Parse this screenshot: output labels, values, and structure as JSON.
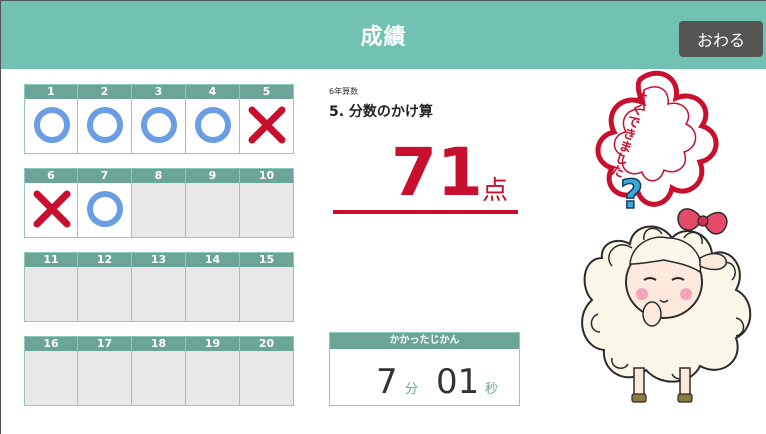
{
  "header": {
    "title": "成績",
    "quit_label": "おわる"
  },
  "rows": [
    [
      {
        "n": "1",
        "mark": "circle"
      },
      {
        "n": "2",
        "mark": "circle"
      },
      {
        "n": "3",
        "mark": "circle"
      },
      {
        "n": "4",
        "mark": "circle"
      },
      {
        "n": "5",
        "mark": "cross"
      }
    ],
    [
      {
        "n": "6",
        "mark": "cross"
      },
      {
        "n": "7",
        "mark": "circle"
      },
      {
        "n": "8",
        "mark": ""
      },
      {
        "n": "9",
        "mark": ""
      },
      {
        "n": "10",
        "mark": ""
      }
    ],
    [
      {
        "n": "11",
        "mark": ""
      },
      {
        "n": "12",
        "mark": ""
      },
      {
        "n": "13",
        "mark": ""
      },
      {
        "n": "14",
        "mark": ""
      },
      {
        "n": "15",
        "mark": ""
      }
    ],
    [
      {
        "n": "16",
        "mark": ""
      },
      {
        "n": "17",
        "mark": ""
      },
      {
        "n": "18",
        "mark": ""
      },
      {
        "n": "19",
        "mark": ""
      },
      {
        "n": "20",
        "mark": ""
      }
    ]
  ],
  "lesson": {
    "subject": "6年算数",
    "unit": "5. 分数のかけ算"
  },
  "score": {
    "value": "71",
    "unit": "点"
  },
  "time": {
    "label": "かかったじかん",
    "minutes": "7",
    "minutes_unit": "分",
    "seconds": "01",
    "seconds_unit": "秒"
  },
  "stamp": {
    "text": "よくできました"
  },
  "colors": {
    "header": "#72c2b4",
    "accent": "#6ba597",
    "score": "#c8102e",
    "circle": "#6a9de3",
    "cross": "#c8102e"
  }
}
